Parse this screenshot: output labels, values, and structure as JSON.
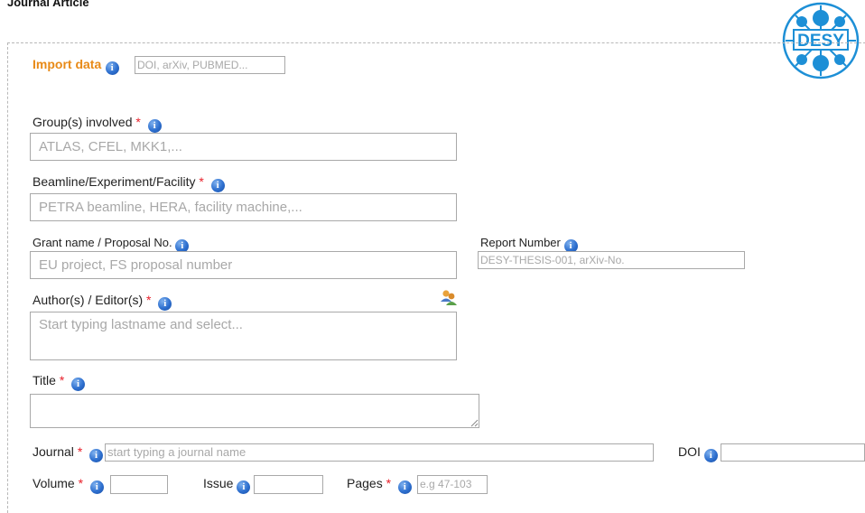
{
  "page": {
    "title": "Journal Article"
  },
  "logo": {
    "text": "DESY"
  },
  "import": {
    "label": "Import data",
    "placeholder": "DOI, arXiv, PUBMED..."
  },
  "info_glyph": "i",
  "required_mark": "*",
  "groups": {
    "label": "Group(s) involved",
    "placeholder": "ATLAS, CFEL, MKK1,..."
  },
  "beamline": {
    "label": "Beamline/Experiment/Facility",
    "placeholder": "PETRA beamline, HERA, facility machine,..."
  },
  "grant": {
    "label": "Grant name / Proposal No.",
    "placeholder": "EU project, FS proposal number"
  },
  "report": {
    "label": "Report Number",
    "placeholder": "DESY-THESIS-001, arXiv-No."
  },
  "authors": {
    "label": "Author(s) / Editor(s)",
    "placeholder": "Start typing lastname and select..."
  },
  "title_field": {
    "label": "Title",
    "value": ""
  },
  "journal": {
    "label": "Journal",
    "placeholder": "start typing a journal name"
  },
  "doi": {
    "label": "DOI",
    "value": ""
  },
  "volume": {
    "label": "Volume",
    "value": ""
  },
  "issue": {
    "label": "Issue",
    "value": ""
  },
  "pages": {
    "label": "Pages",
    "placeholder": "e.g 47-103"
  },
  "colors": {
    "accent": "#e88a17",
    "required": "#e8202a",
    "logo_blue": "#1d8fd6",
    "info_blue": "#2d6fcf"
  }
}
